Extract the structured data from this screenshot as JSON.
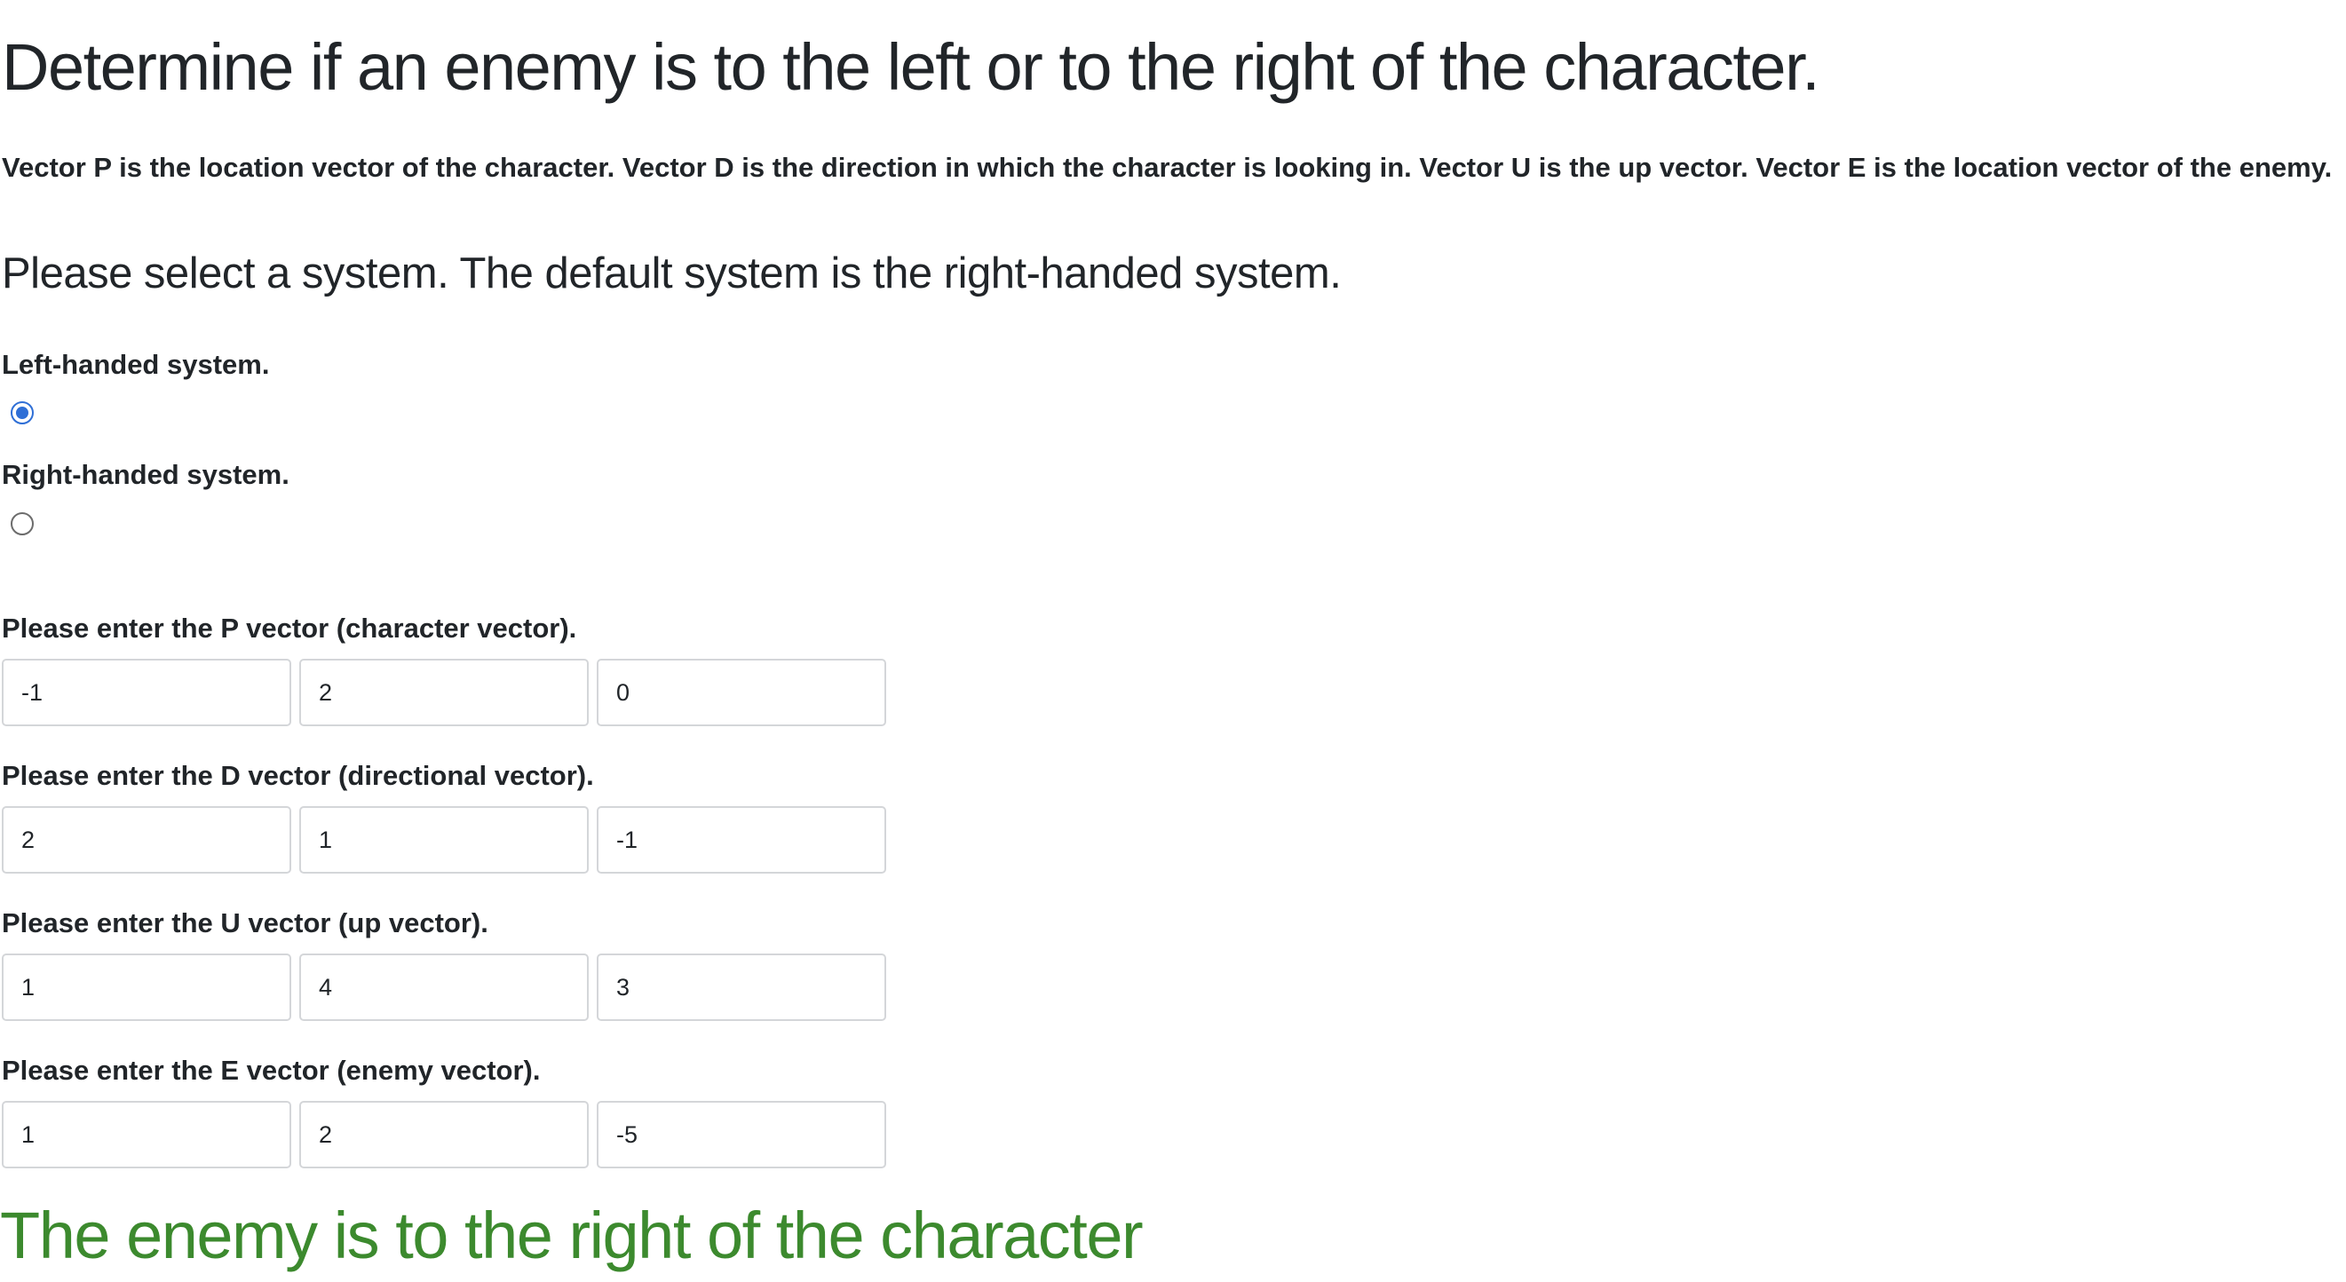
{
  "title": "Determine if an enemy is to the left or to the right of the character.",
  "description": "Vector P is the location vector of the character. Vector D is the direction in which the character is looking in. Vector U is the up vector. Vector E is the location vector of the enemy.",
  "system": {
    "heading": "Please select a system. The default system is the right-handed system.",
    "options": [
      {
        "label": "Left-handed system.",
        "checked": true
      },
      {
        "label": "Right-handed system.",
        "checked": false
      }
    ]
  },
  "vectors": {
    "p": {
      "label": "Please enter the P vector (character vector).",
      "values": [
        "-1",
        "2",
        "0"
      ]
    },
    "d": {
      "label": "Please enter the D vector (directional vector).",
      "values": [
        "2",
        "1",
        "-1"
      ]
    },
    "u": {
      "label": "Please enter the U vector (up vector).",
      "values": [
        "1",
        "4",
        "3"
      ]
    },
    "e": {
      "label": "Please enter the E vector (enemy vector).",
      "values": [
        "1",
        "2",
        "-5"
      ]
    }
  },
  "result": {
    "text": "The enemy is to the right of the character",
    "color": "#3c8a2e"
  },
  "colors": {
    "radio_accent": "#2f6fd6",
    "input_border": "#d4d6d9"
  }
}
